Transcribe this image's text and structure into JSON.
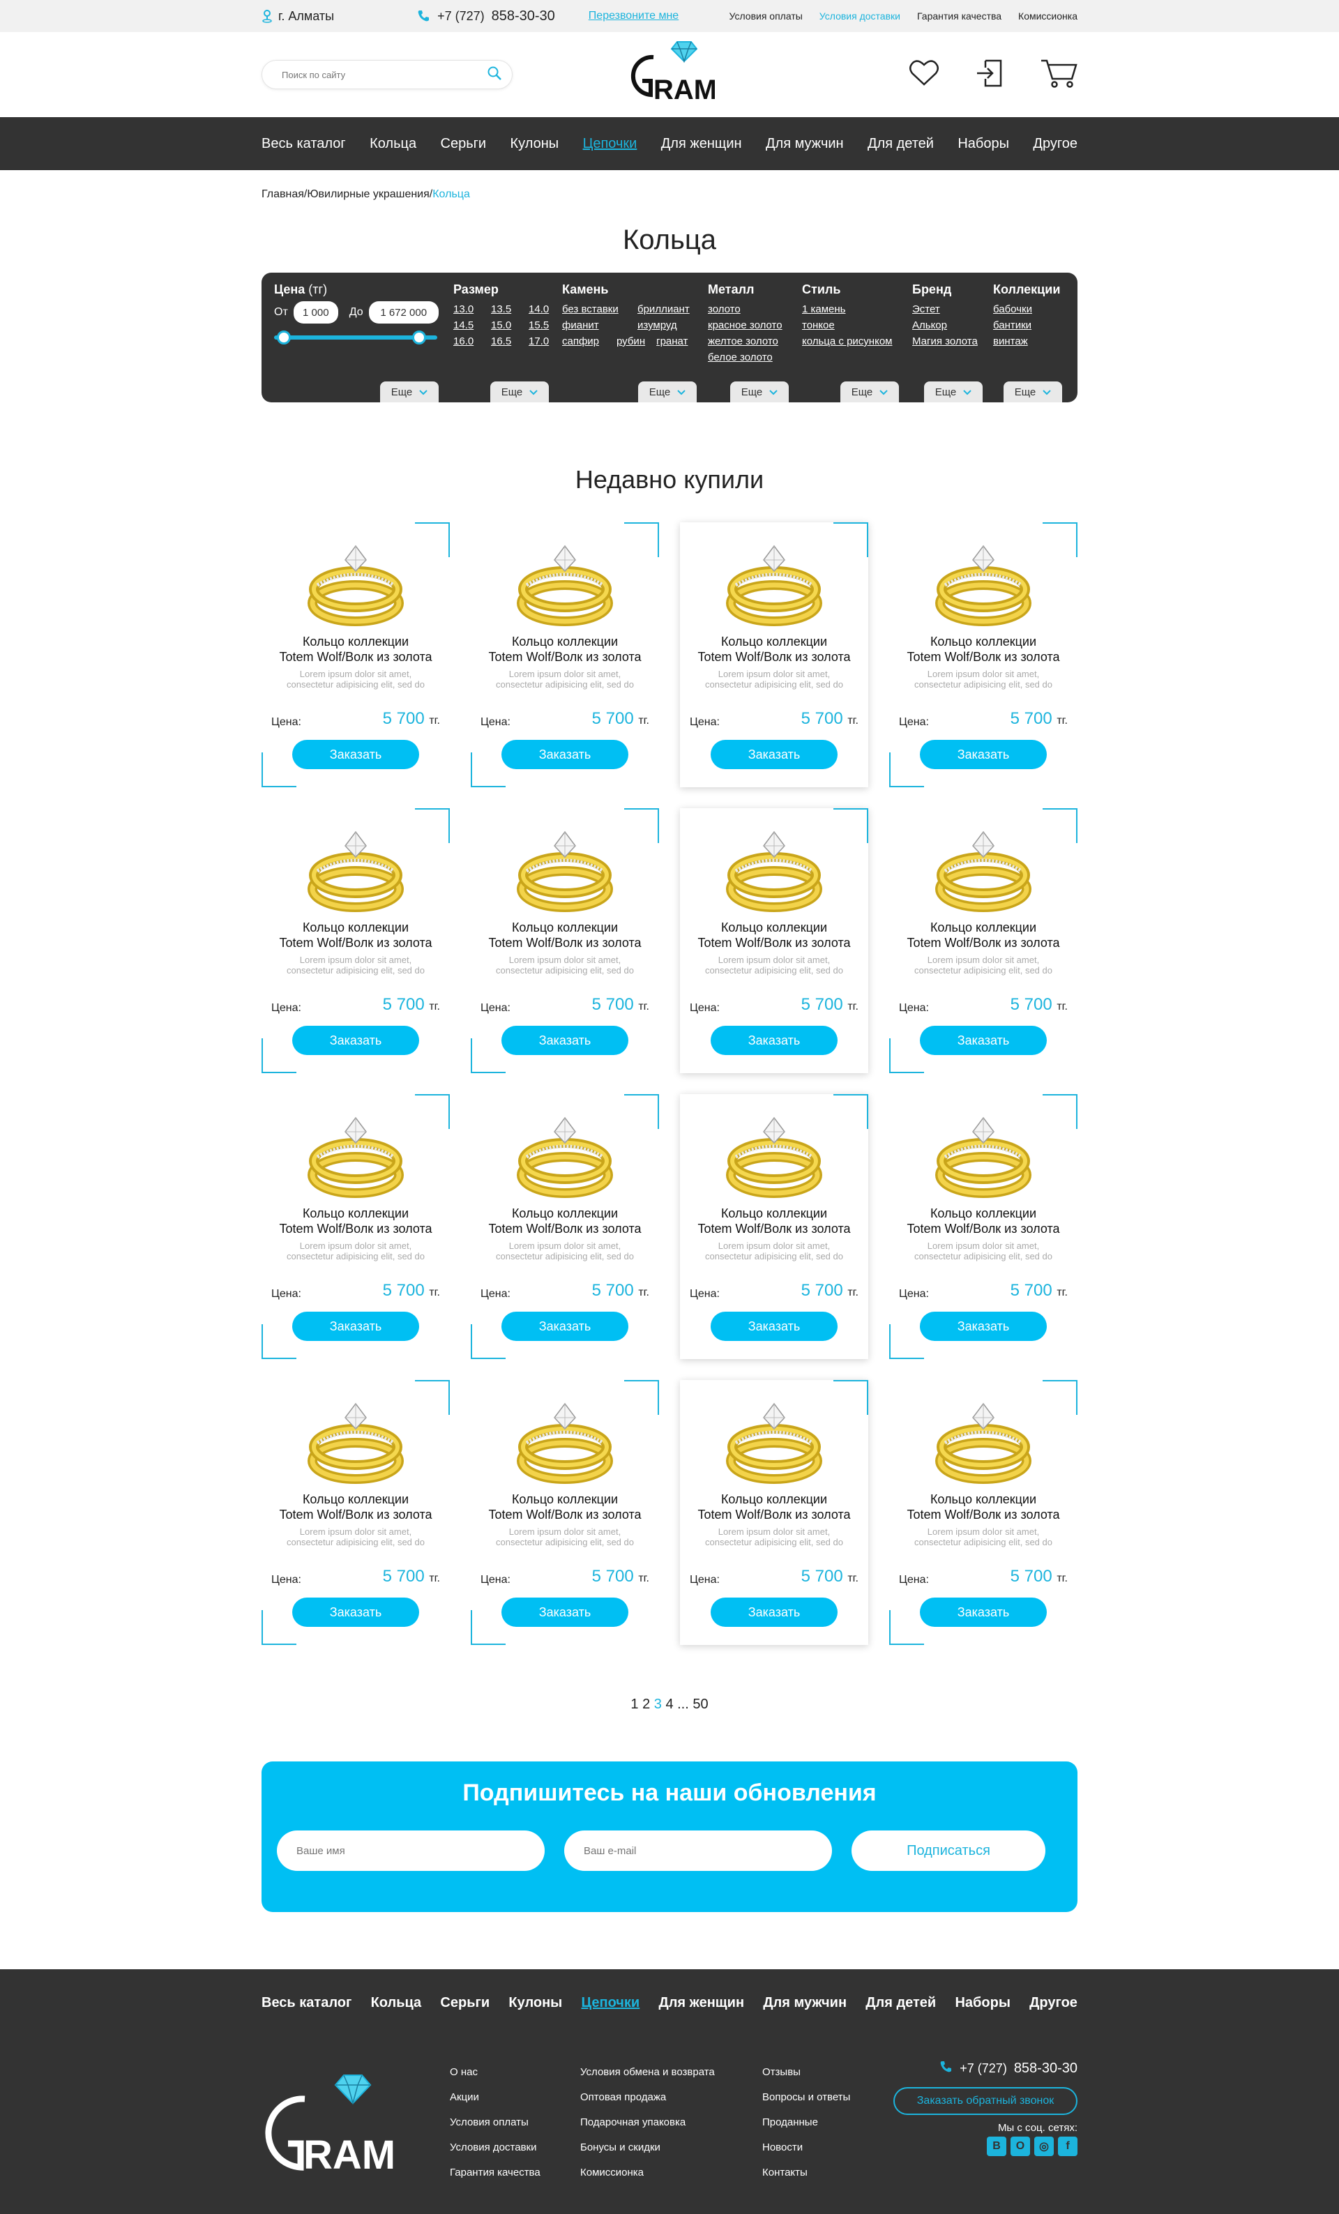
{
  "topbar": {
    "city": "г. Алматы",
    "phone_prefix": "+7 (727)",
    "phone_number": "858-30-30",
    "callback": "Перезвоните мне",
    "links": [
      "Условия оплаты",
      "Условия доставки",
      "Гарантия качества",
      "Комиссионка"
    ]
  },
  "search": {
    "placeholder": "Поиск по сайту"
  },
  "brand": {
    "name": "GRAM"
  },
  "nav": [
    "Весь каталог",
    "Кольца",
    "Серьги",
    "Кулоны",
    "Цепочки",
    "Для женщин",
    "Для мужчин",
    "Для детей",
    "Наборы",
    "Другое"
  ],
  "breadcrumb": {
    "home": "Главная",
    "sep": "/",
    "section": "Ювилирные украшения",
    "current": "Кольца"
  },
  "page_title": "Кольца",
  "filter": {
    "price": {
      "title": "Цена",
      "unit": "(тг)",
      "from_label": "От",
      "from": "1 000",
      "to_label": "До",
      "to": "1 672 000"
    },
    "size": {
      "title": "Размер",
      "options": [
        "13.0",
        "13.5",
        "14.0",
        "14.5",
        "15.0",
        "15.5",
        "16.0",
        "16.5",
        "17.0"
      ]
    },
    "stone": {
      "title": "Камень",
      "options": [
        "без вставки",
        "бриллиант",
        "фианит",
        "изумруд",
        "сапфир",
        "рубин",
        "гранат"
      ]
    },
    "metal": {
      "title": "Металл",
      "options": [
        "золото",
        "красное золото",
        "желтое золото",
        "белое золото"
      ]
    },
    "style": {
      "title": "Стиль",
      "options": [
        "1 камень",
        "тонкое",
        "кольца с рисунком"
      ]
    },
    "brand": {
      "title": "Бренд",
      "options": [
        "Эстет",
        "Алькор",
        "Магия золота"
      ]
    },
    "collections": {
      "title": "Коллекции",
      "options": [
        "бабочки",
        "бантики",
        "винтаж"
      ]
    },
    "more_label": "Еще"
  },
  "section_title": "Недавно купили",
  "product": {
    "title_line1": "Кольцо коллекции",
    "title_line2": "Totem Wolf/Волк из золота",
    "desc_line1": "Lorem ipsum dolor sit amet,",
    "desc_line2": "consectetur adipisicing elit, sed do",
    "price_label": "Цена:",
    "price": "5 700",
    "currency": "тг.",
    "order_label": "Заказать"
  },
  "pagination": [
    "1",
    "2",
    "3",
    "4",
    "...",
    "50"
  ],
  "subscribe": {
    "title": "Подпишитесь на наши обновления",
    "name_placeholder": "Ваше имя",
    "email_placeholder": "Ваш e-mail",
    "button": "Подписаться"
  },
  "footer": {
    "nav": [
      "Весь каталог",
      "Кольца",
      "Серьги",
      "Кулоны",
      "Цепочки",
      "Для женщин",
      "Для мужчин",
      "Для детей",
      "Наборы",
      "Другое"
    ],
    "col1": [
      "О нас",
      "Акции",
      "Условия оплаты",
      "Условия доставки",
      "Гарантия качества"
    ],
    "col2": [
      "Условия обмена и возврата",
      "Оптовая продажа",
      "Подарочная упаковка",
      "Бонусы и скидки",
      "Комиссионка"
    ],
    "col3": [
      "Отзывы",
      "Вопросы и ответы",
      "Проданные",
      "Новости",
      "Контакты"
    ],
    "phone_prefix": "+7 (727)",
    "phone_number": "858-30-30",
    "callback": "Заказать обратный звонок",
    "social_title": "Мы с соц. сетях:",
    "social": [
      "В",
      "О",
      "◎",
      "f"
    ]
  },
  "colors": {
    "accent": "#1cb4dd",
    "dark": "#333333",
    "button": "#00bff3"
  }
}
